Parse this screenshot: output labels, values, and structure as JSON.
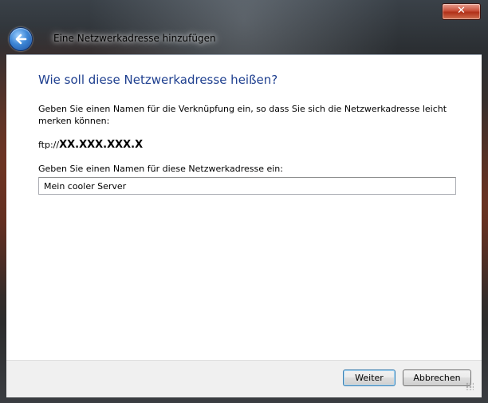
{
  "window": {
    "title": "Eine Netzwerkadresse hinzufügen",
    "close_label": "✕"
  },
  "content": {
    "heading": "Wie soll diese Netzwerkadresse heißen?",
    "instruction": "Geben Sie einen Namen für die Verknüpfung ein, so dass Sie sich die Netzwerkadresse leicht merken können:",
    "address_prefix": "ftp://",
    "address_value": "XX.XXX.XXX.X",
    "name_label": "Geben Sie einen Namen für diese Netzwerkadresse ein:",
    "name_value": "Mein cooler Server"
  },
  "footer": {
    "next_label": "Weiter",
    "cancel_label": "Abbrechen"
  },
  "icons": {
    "back": "back-arrow-icon",
    "close": "close-icon",
    "grip": "resize-grip-icon"
  },
  "colors": {
    "heading": "#1e3f8f",
    "close_button": "#c9503a",
    "back_button": "#3d86d6"
  }
}
